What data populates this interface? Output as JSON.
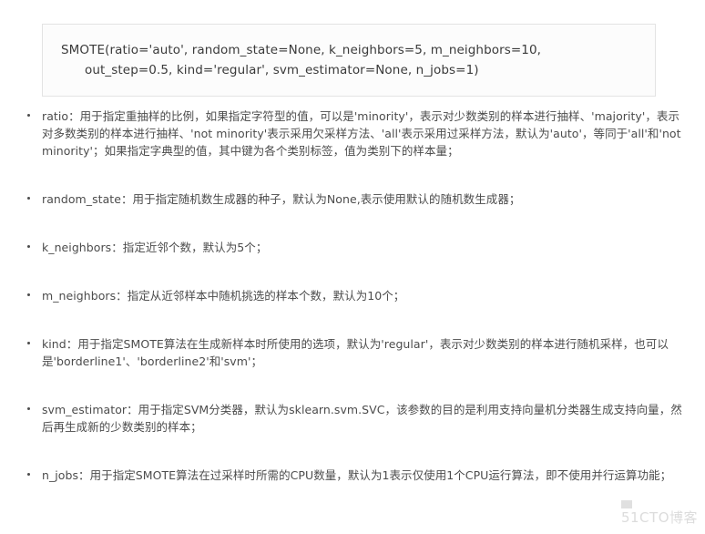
{
  "code_block": {
    "line1": "SMOTE(ratio='auto', random_state=None, k_neighbors=5, m_neighbors=10,",
    "line2": "out_step=0.5, kind='regular', svm_estimator=None, n_jobs=1)"
  },
  "parameters": [
    {
      "name": "ratio",
      "text": "ratio：用于指定重抽样的比例，如果指定字符型的值，可以是'minority'，表示对少数类别的样本进行抽样、'majority'，表示对多数类别的样本进行抽样、'not minority'表示采用欠采样方法、'all'表示采用过采样方法，默认为'auto'，等同于'all'和'not minority'；如果指定字典型的值，其中键为各个类别标签，值为类别下的样本量；"
    },
    {
      "name": "random_state",
      "text": "random_state：用于指定随机数生成器的种子，默认为None,表示使用默认的随机数生成器；"
    },
    {
      "name": "k_neighbors",
      "text": "k_neighbors：指定近邻个数，默认为5个；"
    },
    {
      "name": "m_neighbors",
      "text": "m_neighbors：指定从近邻样本中随机挑选的样本个数，默认为10个；"
    },
    {
      "name": "kind",
      "text": "kind：用于指定SMOTE算法在生成新样本时所使用的选项，默认为'regular'，表示对少数类别的样本进行随机采样，也可以是'borderline1'、'borderline2'和'svm'；"
    },
    {
      "name": "svm_estimator",
      "text": "svm_estimator：用于指定SVM分类器，默认为sklearn.svm.SVC，该参数的目的是利用支持向量机分类器生成支持向量，然后再生成新的少数类别的样本；"
    },
    {
      "name": "n_jobs",
      "text": "n_jobs：用于指定SMOTE算法在过采样时所需的CPU数量，默认为1表示仅使用1个CPU运行算法，即不使用并行运算功能；"
    }
  ],
  "watermark": {
    "text": "51CTO博客"
  }
}
